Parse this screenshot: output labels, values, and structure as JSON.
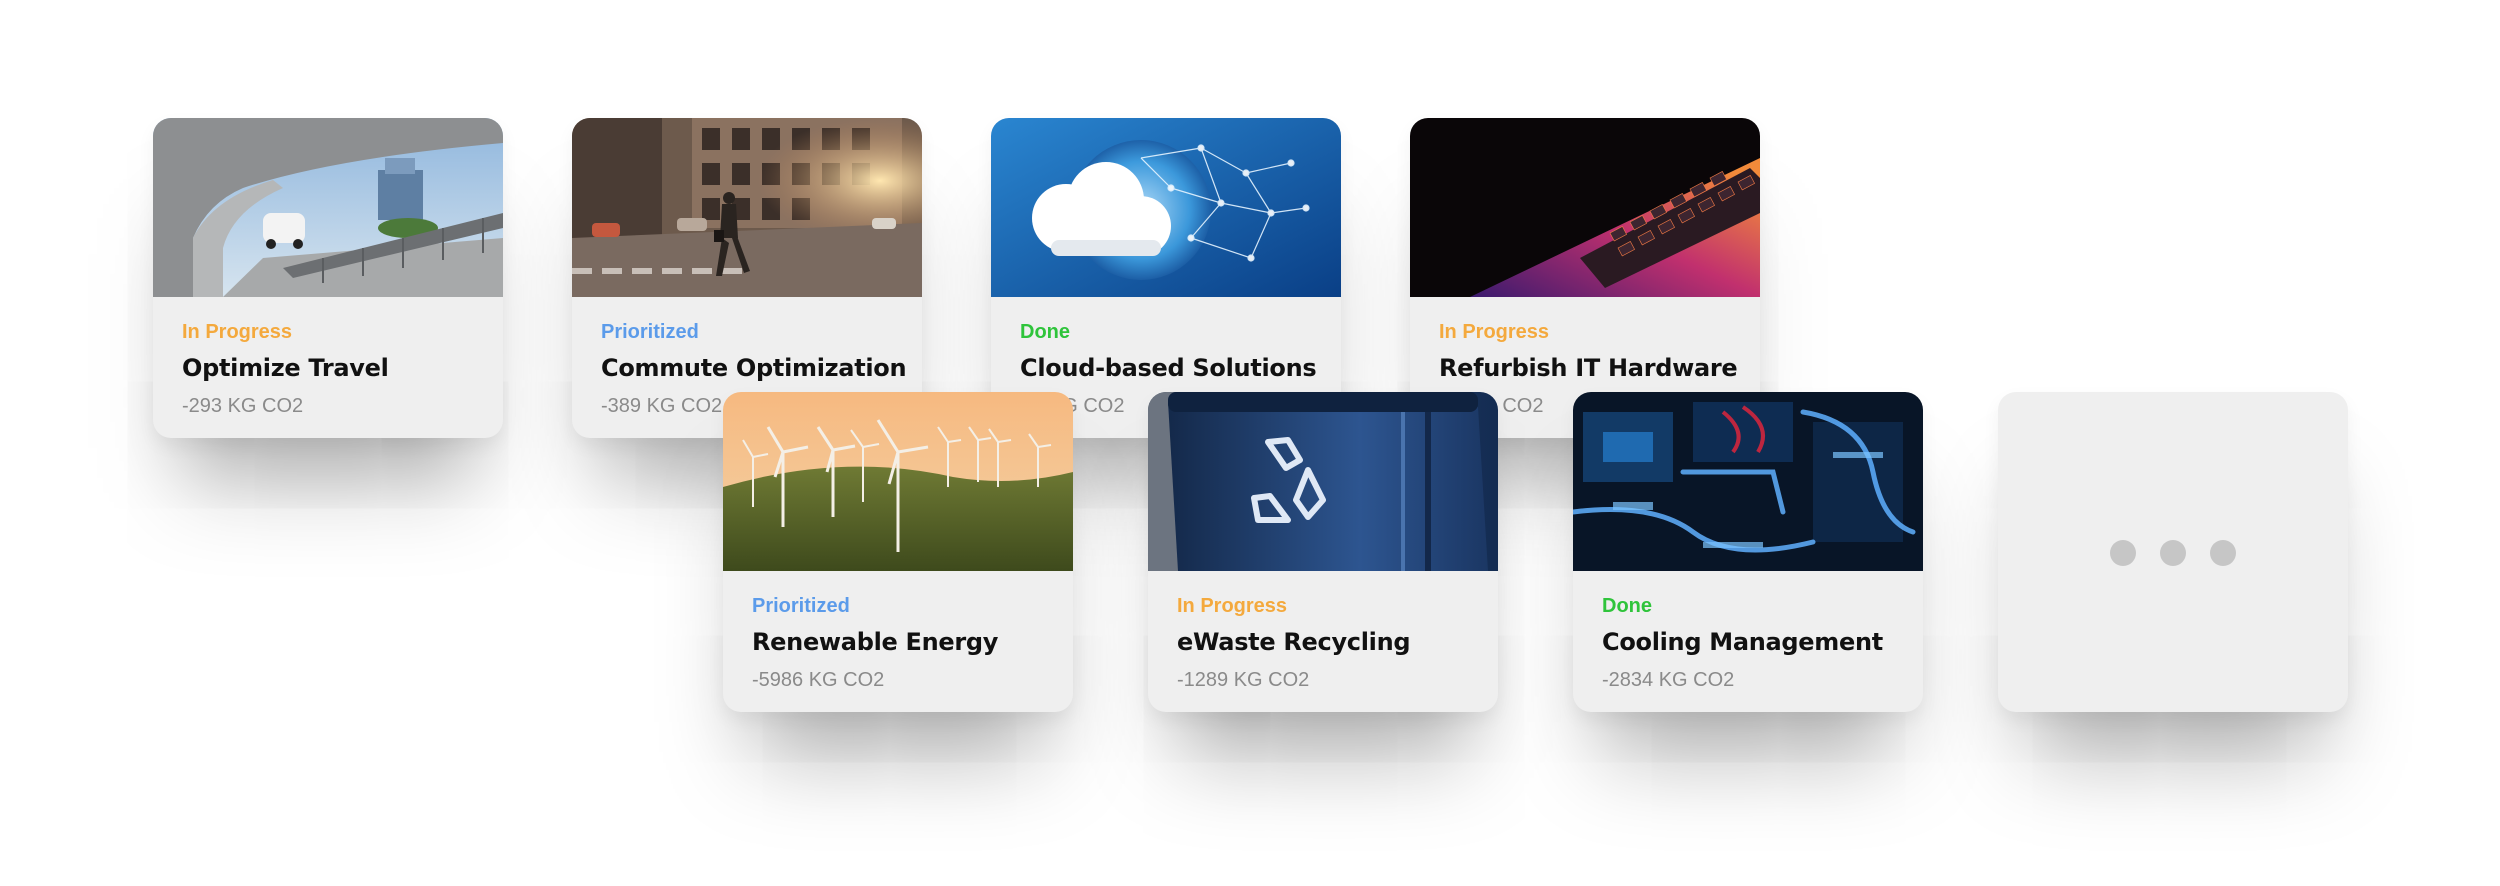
{
  "cards": [
    {
      "status": "In Progress",
      "title": "Optimize Travel",
      "amount": "-293 KG CO2",
      "image": "car-on-bridge-photo"
    },
    {
      "status": "Prioritized",
      "title": "Commute Optimization",
      "amount": "-389 KG CO2",
      "image": "city-commuter-photo"
    },
    {
      "status": "Done",
      "title": "Cloud-based Solutions",
      "amount": "-... KG CO2",
      "image": "cloud-network-globe-photo"
    },
    {
      "status": "In Progress",
      "title": "Refurbish IT Hardware",
      "amount": "-... KG CO2",
      "image": "laptop-keyboard-photo"
    },
    {
      "status": "Prioritized",
      "title": "Renewable Energy",
      "amount": "-5986 KG CO2",
      "image": "wind-turbines-photo"
    },
    {
      "status": "In Progress",
      "title": "eWaste Recycling",
      "amount": "-1289 KG CO2",
      "image": "recycling-bin-photo"
    },
    {
      "status": "Done",
      "title": "Cooling Management",
      "amount": "-2834 KG CO2",
      "image": "server-cooling-photo"
    }
  ],
  "more": {
    "icon": "more-dots-icon"
  },
  "colors": {
    "in_progress": "#f4a93d",
    "prioritized": "#5b9bea",
    "done": "#2fc43b"
  }
}
